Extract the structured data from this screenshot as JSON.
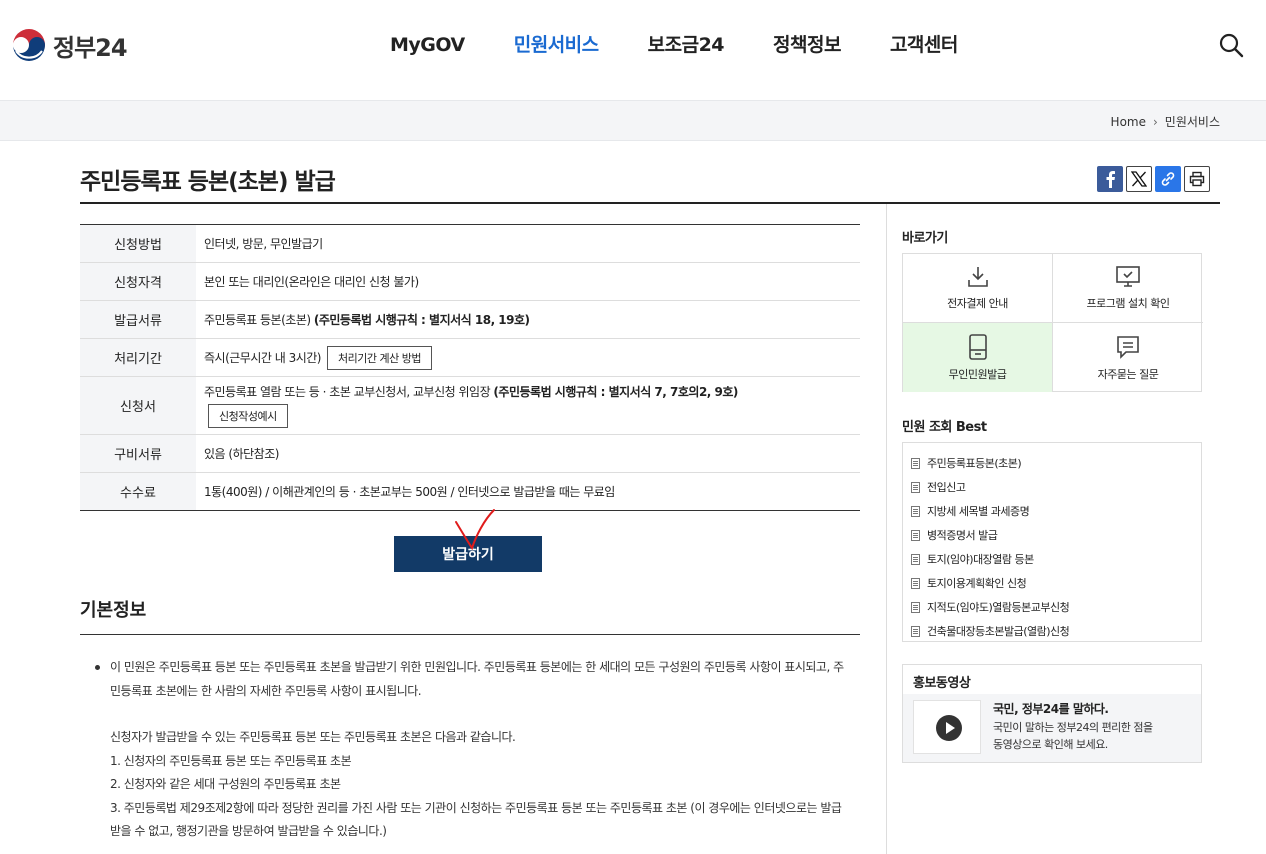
{
  "header": {
    "logo_text": "정부24",
    "nav": [
      "MyGOV",
      "민원서비스",
      "보조금24",
      "정책정보",
      "고객센터"
    ],
    "active_nav": 1
  },
  "breadcrumb": {
    "home": "Home",
    "current": "민원서비스"
  },
  "page": {
    "title": "주민등록표 등본(초본) 발급"
  },
  "info": {
    "rows": [
      {
        "label": "신청방법",
        "value": "인터넷, 방문, 무인발급기"
      },
      {
        "label": "신청자격",
        "value": "본인 또는 대리인(온라인은 대리인 신청 불가)"
      },
      {
        "label": "발급서류",
        "value": "주민등록표 등본(초본) ",
        "bold": "(주민등록법 시행규칙 : 별지서식 18, 19호)"
      },
      {
        "label": "처리기간",
        "value": "즉시(근무시간 내 3시간)",
        "button": "처리기간 계산 방법"
      },
      {
        "label": "신청서",
        "value": "주민등록표 열람 또는 등 · 초본 교부신청서, 교부신청 위임장 ",
        "bold": "(주민등록법 시행규칙 : 별지서식 7, 7호의2, 9호)",
        "button": "신청작성예시"
      },
      {
        "label": "구비서류",
        "value": "있음 (하단참조)"
      },
      {
        "label": "수수료",
        "value": "1통(400원) / 이해관계인의 등 · 초본교부는 500원 / 인터넷으로 발급받을 때는 무료임"
      }
    ],
    "issue_button": "발급하기"
  },
  "basic_info": {
    "title": "기본정보",
    "para1_line1": "이 민원은 주민등록표 등본 또는 주민등록표 초본을 발급받기 위한 민원입니다. 주민등록표 등본에는 한 세대의 모든 구성원의 주민등록 사항이 표시되고, 주",
    "para1_line2": "민등록표 초본에는 한 사람의 자세한 주민등록 사항이 표시됩니다.",
    "para2_intro": "신청자가 발급받을 수 있는 주민등록표 등본 또는 주민등록표 초본은 다음과 같습니다.",
    "item1": "1. 신청자의 주민등록표 등본 또는 주민등록표 초본",
    "item2": "2. 신청자와 같은 세대 구성원의 주민등록표 초본",
    "item3_line1": "3. 주민등록법 제29조제2항에 따라 정당한 권리를 가진 사람 또는 기관이 신청하는 주민등록표 등본 또는 주민등록표 초본 (이 경우에는 인터넷으로는 발급",
    "item3_line2": "받을 수 없고, 행정기관을 방문하여 발급받을 수 있습니다.)"
  },
  "sidebar": {
    "shortcut_title": "바로가기",
    "shortcuts": [
      {
        "label": "전자결제 안내",
        "icon": "download-icon"
      },
      {
        "label": "프로그램 설치 확인",
        "icon": "monitor-check-icon"
      },
      {
        "label": "무인민원발급",
        "icon": "kiosk-icon"
      },
      {
        "label": "자주묻는 질문",
        "icon": "chat-icon"
      }
    ],
    "best_title": "민원 조회 Best",
    "best_items": [
      "주민등록표등본(초본)",
      "전입신고",
      "지방세 세목별 과세증명",
      "병적증명서 발급",
      "토지(임야)대장열람 등본",
      "토지이용계획확인 신청",
      "지적도(임야도)열람등본교부신청",
      "건축물대장등초본발급(열람)신청"
    ],
    "promo_title": "홍보동영상",
    "promo_video_title": "국민, 정부24를 말하다.",
    "promo_desc_line1": "국민이 말하는 정부24의 편리한 점을",
    "promo_desc_line2": "동영상으로 확인해 보세요."
  },
  "colors": {
    "accent_blue": "#1a6ad1",
    "issue_button": "#123a67",
    "highlight_green": "#e6f8e4",
    "annotation_red": "#e01c1c"
  }
}
